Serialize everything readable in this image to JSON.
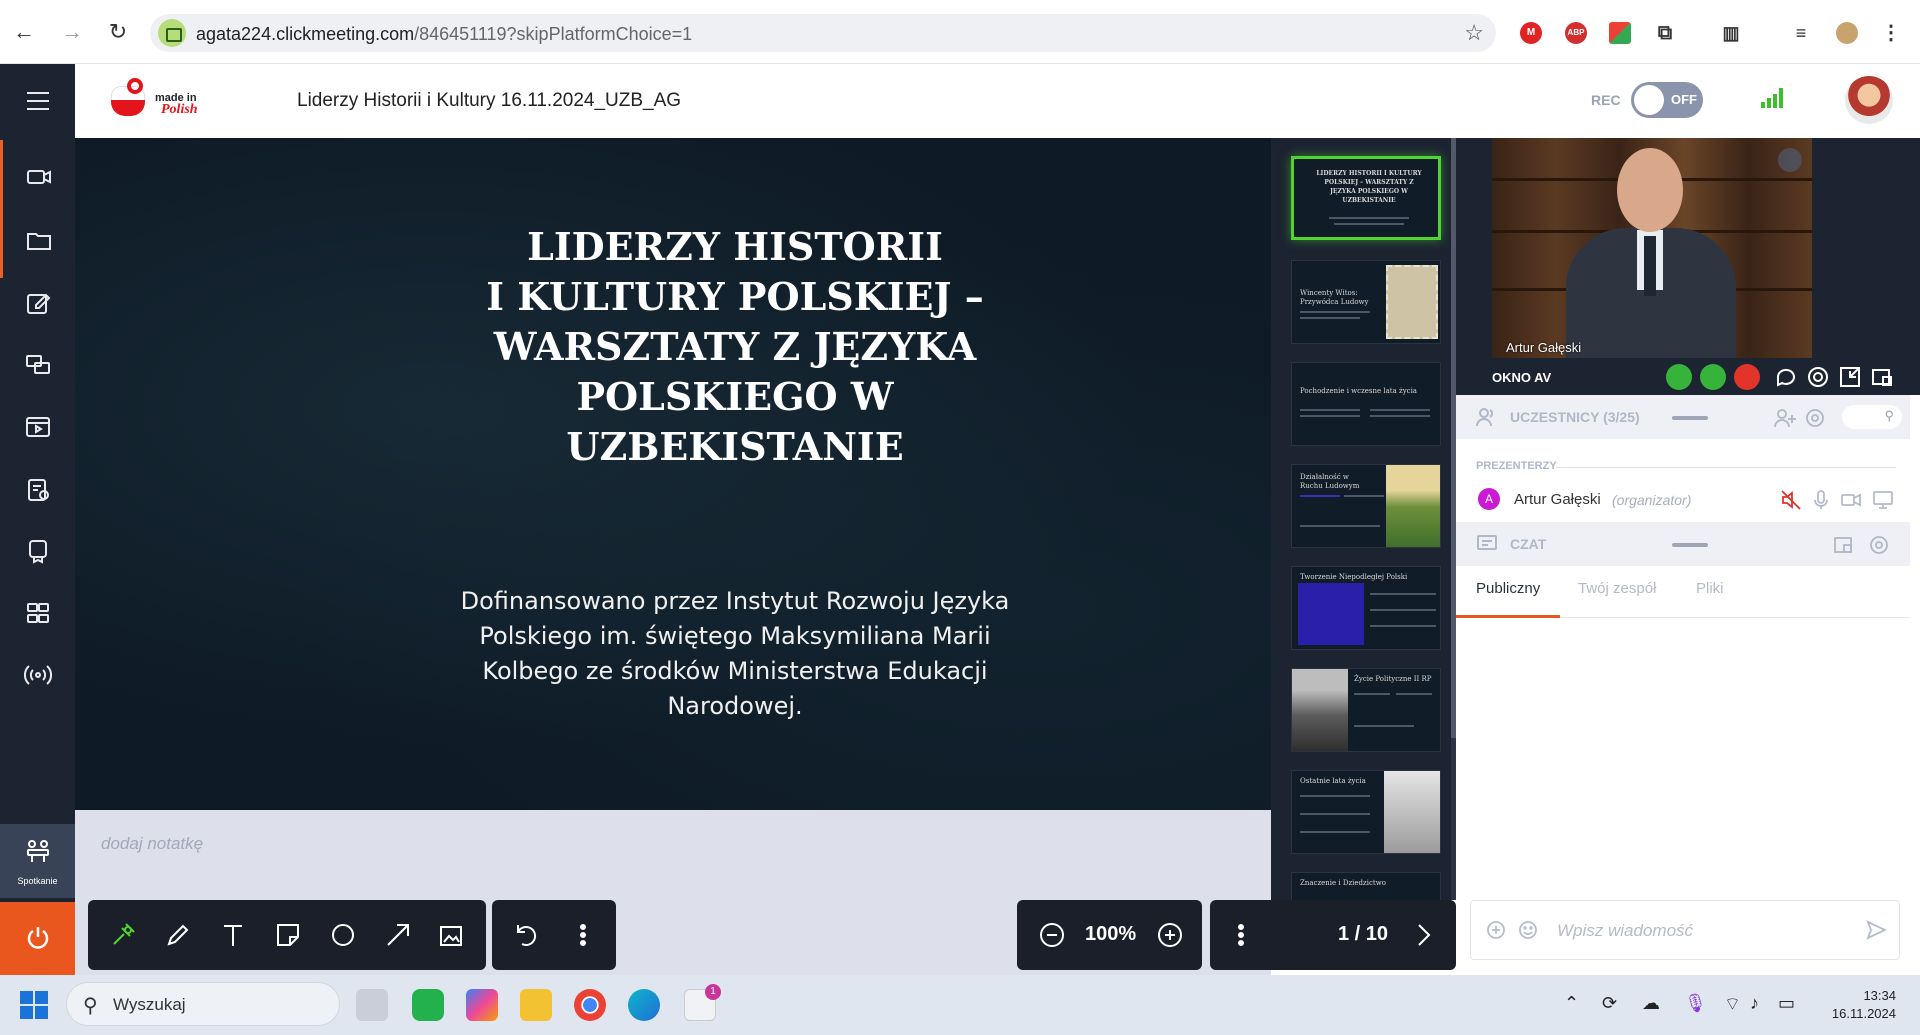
{
  "browser": {
    "url_host": "agata224.clickmeeting.com",
    "url_path": "/846451119?skipPlatformChoice=1",
    "ext_badges": [
      "M",
      "ABP"
    ]
  },
  "header": {
    "logo_top": "made in",
    "logo_bottom": "Polish",
    "meeting_title": "Liderzy Historii i Kultury 16.11.2024_UZB_AG",
    "rec_label": "REC",
    "rec_toggle": "OFF"
  },
  "sidebar": {
    "meeting_label": "Spotkanie"
  },
  "slide": {
    "title_lines": [
      "LIDERZY HISTORII",
      "I KULTURY POLSKIEJ –",
      "WARSZTATY Z JĘZYKA",
      "POLSKIEGO W",
      "UZBEKISTANIE"
    ],
    "body_lines": [
      "Dofinansowano przez Instytut Rozwoju Języka",
      "Polskiego im. świętego Maksymiliana Marii",
      "Kolbego ze środków Ministerstwa Edukacji",
      "Narodowej."
    ]
  },
  "notes": {
    "placeholder": "dodaj notatkę"
  },
  "thumbnails": [
    {
      "title": "LIDERZY HISTORII I KULTURY POLSKIEJ – WARSZTATY Z JĘZYKA POLSKIEGO W UZBEKISTANIE"
    },
    {
      "title": "Wincenty Witos: Przywódca Ludowy"
    },
    {
      "title": "Pochodzenie i wczesne lata życia"
    },
    {
      "title": "Działalność w Ruchu Ludowym"
    },
    {
      "title": "Tworzenie Niepodległej Polski"
    },
    {
      "title": "Życie Polityczne II RP"
    },
    {
      "title": "Ostatnie lata życia"
    },
    {
      "title": "Znaczenie i Dziedzictwo"
    }
  ],
  "zoom": {
    "value": "100%"
  },
  "pager": {
    "value": "1 / 10"
  },
  "video": {
    "person_name": "Artur Gałęski",
    "panel_label": "OKNO AV"
  },
  "participants": {
    "header_label": "UCZESTNICY (3/25)",
    "presenters_label": "PREZENTERZY",
    "presenter": {
      "initial": "A",
      "name": "Artur Gałęski",
      "role": "(organizator)"
    }
  },
  "chat": {
    "header_label": "CZAT",
    "tabs": [
      "Publiczny",
      "Twój zespół",
      "Pliki"
    ],
    "input_placeholder": "Wpisz wiadomość"
  },
  "taskbar": {
    "search_label": "Wyszukaj",
    "time": "13:34",
    "date": "16.11.2024",
    "store_badge": "1"
  },
  "colors": {
    "accent_orange": "#e9561e",
    "active_green": "#4fd62e",
    "sidebar_bg": "#1c2331"
  }
}
